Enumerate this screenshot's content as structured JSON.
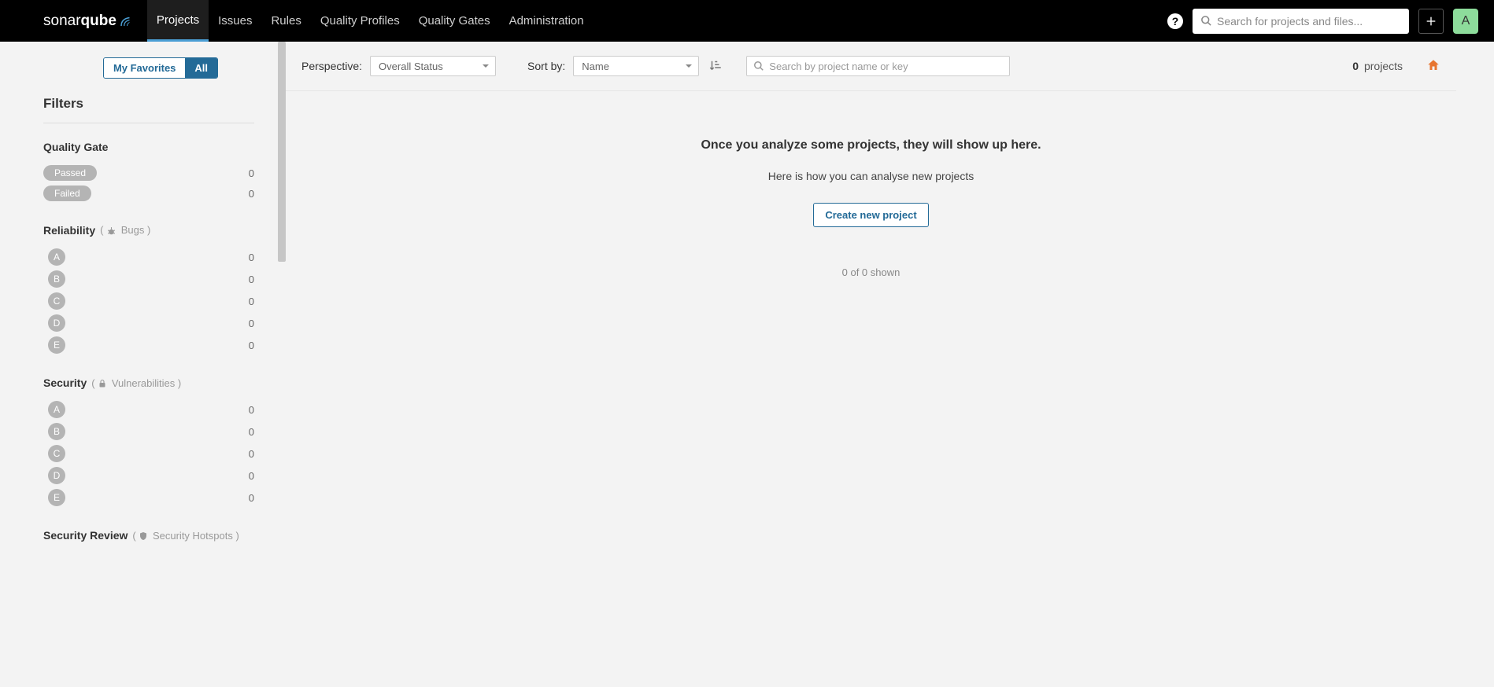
{
  "brand": {
    "part1": "sonar",
    "part2": "qube"
  },
  "nav": {
    "projects": "Projects",
    "issues": "Issues",
    "rules": "Rules",
    "quality_profiles": "Quality Profiles",
    "quality_gates": "Quality Gates",
    "administration": "Administration"
  },
  "global_search": {
    "placeholder": "Search for projects and files..."
  },
  "avatar_letter": "A",
  "sidebar": {
    "toggle": {
      "favorites": "My Favorites",
      "all": "All"
    },
    "filters_title": "Filters",
    "quality_gate": {
      "title": "Quality Gate",
      "passed": {
        "label": "Passed",
        "count": "0"
      },
      "failed": {
        "label": "Failed",
        "count": "0"
      }
    },
    "reliability": {
      "title": "Reliability",
      "sub": "Bugs",
      "ratings": [
        {
          "letter": "A",
          "count": "0"
        },
        {
          "letter": "B",
          "count": "0"
        },
        {
          "letter": "C",
          "count": "0"
        },
        {
          "letter": "D",
          "count": "0"
        },
        {
          "letter": "E",
          "count": "0"
        }
      ]
    },
    "security": {
      "title": "Security",
      "sub": "Vulnerabilities",
      "ratings": [
        {
          "letter": "A",
          "count": "0"
        },
        {
          "letter": "B",
          "count": "0"
        },
        {
          "letter": "C",
          "count": "0"
        },
        {
          "letter": "D",
          "count": "0"
        },
        {
          "letter": "E",
          "count": "0"
        }
      ]
    },
    "security_review": {
      "title": "Security Review",
      "sub": "Security Hotspots"
    }
  },
  "toolbar": {
    "perspective_label": "Perspective:",
    "perspective_value": "Overall Status",
    "sort_label": "Sort by:",
    "sort_value": "Name",
    "search_placeholder": "Search by project name or key",
    "count_number": "0",
    "count_word": "projects"
  },
  "empty": {
    "heading": "Once you analyze some projects, they will show up here.",
    "sub": "Here is how you can analyse new projects",
    "button": "Create new project",
    "shown": "0 of 0 shown"
  }
}
